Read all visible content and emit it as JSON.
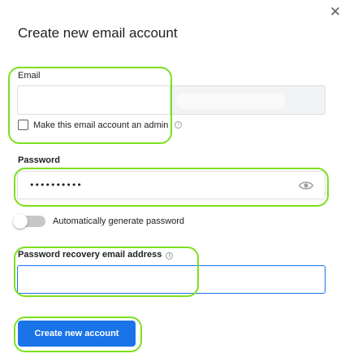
{
  "dialog": {
    "title": "Create new email account",
    "close_icon": "close-icon"
  },
  "email": {
    "label": "Email",
    "value": "",
    "domain": "",
    "admin_checkbox_label": "Make this email account an admin",
    "admin_checked": false,
    "info_icon": "info-icon"
  },
  "password": {
    "label": "Password",
    "masked_value": "••••••••••",
    "visibility_icon": "eye-icon"
  },
  "auto_generate": {
    "label": "Automatically generate password",
    "enabled": false
  },
  "recovery": {
    "label": "Password recovery email address",
    "value": "",
    "info_icon": "info-icon"
  },
  "actions": {
    "create_label": "Create new account"
  },
  "colors": {
    "accent": "#1a73e8",
    "highlight": "#7ee01f"
  }
}
